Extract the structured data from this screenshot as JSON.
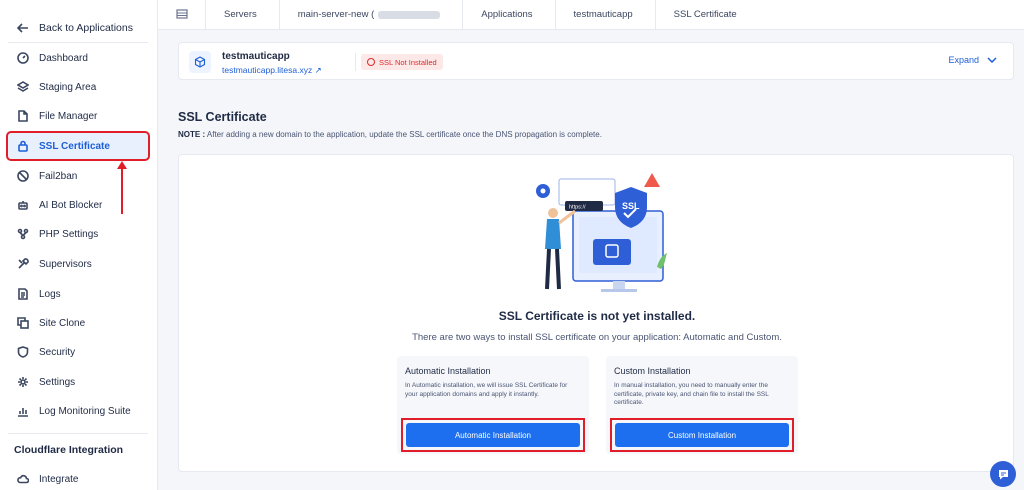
{
  "sidebar": {
    "back_label": "Back to Applications",
    "items": [
      {
        "label": "Dashboard",
        "icon": "gauge-icon"
      },
      {
        "label": "Staging Area",
        "icon": "layers-icon"
      },
      {
        "label": "File Manager",
        "icon": "file-icon"
      },
      {
        "label": "SSL Certificate",
        "icon": "lock-icon",
        "active": true
      },
      {
        "label": "Fail2ban",
        "icon": "ban-icon"
      },
      {
        "label": "AI Bot Blocker",
        "icon": "robot-icon"
      },
      {
        "label": "PHP Settings",
        "icon": "nodes-icon"
      },
      {
        "label": "Supervisors",
        "icon": "tools-icon"
      },
      {
        "label": "Logs",
        "icon": "doc-icon"
      },
      {
        "label": "Site Clone",
        "icon": "copy-icon"
      },
      {
        "label": "Security",
        "icon": "shield-icon"
      },
      {
        "label": "Settings",
        "icon": "gear-icon"
      },
      {
        "label": "Log Monitoring Suite",
        "icon": "chart-icon"
      }
    ],
    "cloudflare_heading": "Cloudflare Integration",
    "integrate_label": "Integrate"
  },
  "breadcrumb": {
    "servers": "Servers",
    "server_name": "main-server-new (",
    "applications": "Applications",
    "app": "testmauticapp",
    "current": "SSL Certificate"
  },
  "app": {
    "name": "testmauticapp",
    "domain": "testmauticapp.litesa.xyz ↗",
    "ssl_status": "SSL Not Installed",
    "expand_label": "Expand"
  },
  "section": {
    "title": "SSL Certificate",
    "note_label": "NOTE :",
    "note_text": " After adding a new domain to the application, update the SSL certificate once the DNS propagation is complete."
  },
  "empty_state": {
    "title": "SSL Certificate is not yet installed.",
    "subtitle": "There are two ways to install SSL certificate on your application: Automatic and Custom.",
    "illustration_url_text": "https://"
  },
  "options": {
    "automatic": {
      "title": "Automatic Installation",
      "desc": "In Automatic installation, we will issue SSL Certificate for your application domains and apply it instantly.",
      "button": "Automatic Installation"
    },
    "custom": {
      "title": "Custom Installation",
      "desc": "In manual installation, you need to manually enter the certificate, private key, and chain file to install the SSL certificate.",
      "button": "Custom Installation"
    }
  },
  "colors": {
    "accent": "#1d6ff0",
    "highlight": "#e11d2a",
    "danger_badge": "#d92d2d"
  }
}
